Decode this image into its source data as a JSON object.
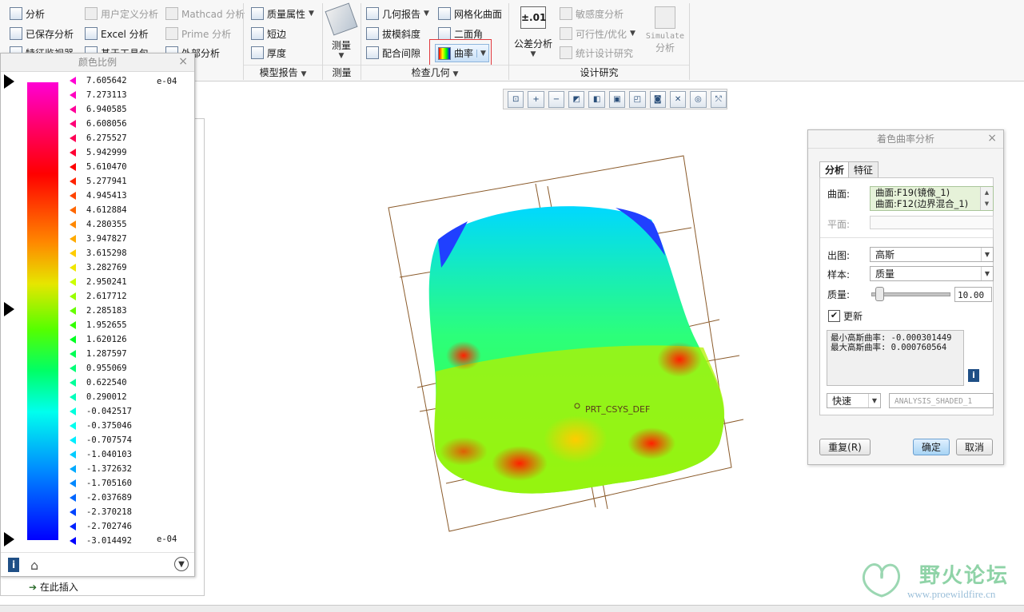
{
  "ribbon": {
    "col1": [
      "分析",
      "已保存分析",
      "特征监视器"
    ],
    "col2": [
      "用户定义分析",
      "Excel 分析",
      "基于工具包"
    ],
    "col3": [
      "Mathcad 分析",
      "Prime 分析",
      "外部分析"
    ],
    "col4": [
      "质量属性",
      "短边",
      "厚度"
    ],
    "measure": "测量",
    "col6": [
      "几何报告",
      "拔模斜度",
      "配合间隙"
    ],
    "col7": [
      "网格化曲面",
      "二面角",
      "曲率"
    ],
    "tolerance_icon_text": "±.01",
    "tolerance": "公差分析",
    "col9": [
      "敏感度分析",
      "可行性/优化",
      "统计设计研究"
    ],
    "simulate": [
      "Simulate",
      "分析"
    ],
    "groups": [
      "模型报告",
      "测量",
      "检查几何",
      "设计研究"
    ]
  },
  "color_scale": {
    "title": "颜色比例",
    "close": "×",
    "exponent_top": "e-04",
    "exponent_bottom": "e-04",
    "ticks": [
      {
        "value": "7.605642",
        "color": "#ff00d4"
      },
      {
        "value": "7.273113",
        "color": "#ff00c0"
      },
      {
        "value": "6.940585",
        "color": "#ff0099"
      },
      {
        "value": "6.608056",
        "color": "#ff0077"
      },
      {
        "value": "6.275527",
        "color": "#ff0055"
      },
      {
        "value": "5.942999",
        "color": "#ff0033"
      },
      {
        "value": "5.610470",
        "color": "#ff0000"
      },
      {
        "value": "5.277941",
        "color": "#ff2200"
      },
      {
        "value": "4.945413",
        "color": "#ff4400"
      },
      {
        "value": "4.612884",
        "color": "#ff6600"
      },
      {
        "value": "4.280355",
        "color": "#ff8800"
      },
      {
        "value": "3.947827",
        "color": "#ffaa00"
      },
      {
        "value": "3.615298",
        "color": "#ffcc00"
      },
      {
        "value": "3.282769",
        "color": "#f0e600"
      },
      {
        "value": "2.950241",
        "color": "#ccff00"
      },
      {
        "value": "2.617712",
        "color": "#99ff00"
      },
      {
        "value": "2.285183",
        "color": "#66ff00"
      },
      {
        "value": "1.952655",
        "color": "#33ff00"
      },
      {
        "value": "1.620126",
        "color": "#00ff22"
      },
      {
        "value": "1.287597",
        "color": "#00ff55"
      },
      {
        "value": "0.955069",
        "color": "#00ff77"
      },
      {
        "value": "0.622540",
        "color": "#00ff99"
      },
      {
        "value": "0.290012",
        "color": "#00ffbb"
      },
      {
        "value": "-0.042517",
        "color": "#00ffdd"
      },
      {
        "value": "-0.375046",
        "color": "#00ffee"
      },
      {
        "value": "-0.707574",
        "color": "#00eeff"
      },
      {
        "value": "-1.040103",
        "color": "#00ccff"
      },
      {
        "value": "-1.372632",
        "color": "#00aaff"
      },
      {
        "value": "-1.705160",
        "color": "#0088ff"
      },
      {
        "value": "-2.037689",
        "color": "#0066ff"
      },
      {
        "value": "-2.370218",
        "color": "#0044ff"
      },
      {
        "value": "-2.702746",
        "color": "#0022ff"
      },
      {
        "value": "-3.014492",
        "color": "#0000ff"
      }
    ]
  },
  "tree": {
    "insert_here": "在此插入"
  },
  "model": {
    "csys_label": "PRT_CSYS_DEF"
  },
  "dialog": {
    "title": "着色曲率分析",
    "close": "×",
    "tabs": [
      "分析",
      "特征"
    ],
    "surface_label": "曲面:",
    "surfaces": [
      "曲面:F19(镜像_1)",
      "曲面:F12(边界混合_1)"
    ],
    "plane_label": "平面:",
    "output_label": "出图:",
    "output_value": "高斯",
    "sample_label": "样本:",
    "sample_value": "质量",
    "quality_label": "质量:",
    "quality_value": "10.00",
    "update_label": "更新",
    "min_label": "最小高斯曲率: -0.000301449",
    "max_label": "最大高斯曲率: 0.000760564",
    "mode_value": "快速",
    "analysis_name": "ANALYSIS_SHADED_1",
    "reset": "重复(R)",
    "ok": "确定",
    "cancel": "取消"
  },
  "watermark": {
    "name": "野火论坛",
    "url": "www.proewildfire.cn"
  }
}
